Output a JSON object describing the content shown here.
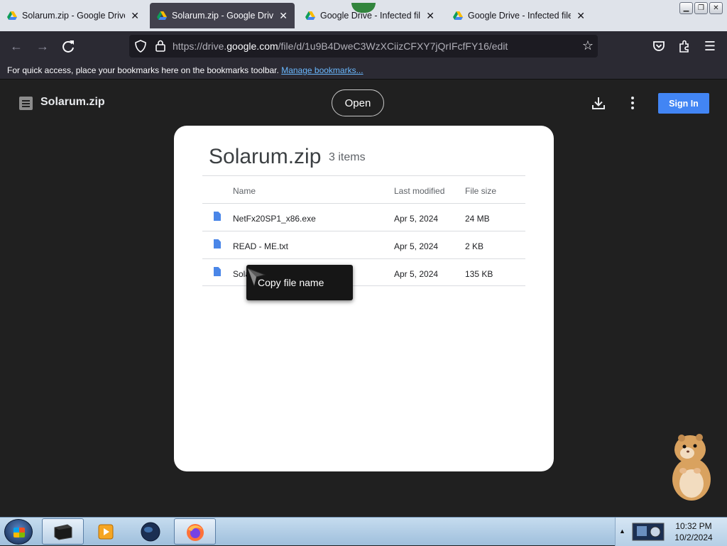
{
  "browser": {
    "tabs": [
      {
        "label": "Solarum.zip - Google Drive",
        "active": false
      },
      {
        "label": "Solarum.zip - Google Drive",
        "active": true
      },
      {
        "label": "Google Drive - Infected file",
        "active": false
      },
      {
        "label": "Google Drive - Infected file",
        "active": false
      }
    ],
    "url_prefix": "https://drive.",
    "url_domain": "google.com",
    "url_path": "/file/d/1u9B4DweC3WzXCiizCFXY7jQrIFcfFY16/edit",
    "bookmarks_message": "For quick access, place your bookmarks here on the bookmarks toolbar.",
    "bookmarks_link": "Manage bookmarks..."
  },
  "drive": {
    "header_title": "Solarum.zip",
    "open_label": "Open",
    "signin_label": "Sign In",
    "archive_title": "Solarum.zip",
    "item_count": "3 items",
    "columns": {
      "name": "Name",
      "modified": "Last modified",
      "size": "File size"
    },
    "files": [
      {
        "name": "NetFx20SP1_x86.exe",
        "modified": "Apr 5, 2024",
        "size": "24 MB"
      },
      {
        "name": "READ - ME.txt",
        "modified": "Apr 5, 2024",
        "size": "2 KB"
      },
      {
        "name": "Sola",
        "modified": "Apr 5, 2024",
        "size": "135 KB"
      }
    ],
    "tooltip": "Copy file name"
  },
  "taskbar": {
    "time": "10:32 PM",
    "date": "10/2/2024"
  },
  "colors": {
    "accent": "#4285f4",
    "page_bg": "#202020",
    "file_icon": "#4a86e8"
  }
}
